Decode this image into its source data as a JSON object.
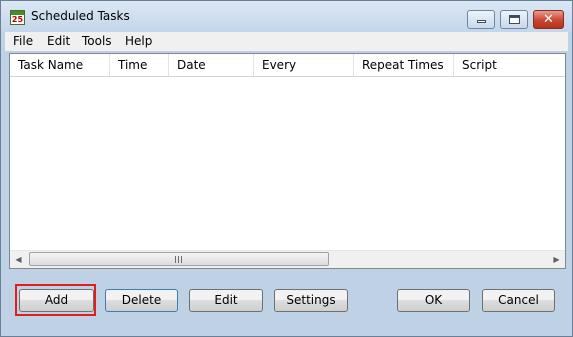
{
  "window": {
    "title": "Scheduled Tasks",
    "icon_name": "calendar-icon",
    "icon_day": "25",
    "controls": {
      "minimize": "minimize-icon",
      "maximize": "maximize-icon",
      "close_glyph": "✕"
    }
  },
  "menu": [
    "File",
    "Edit",
    "Tools",
    "Help"
  ],
  "table": {
    "columns": [
      "Task Name",
      "Time",
      "Date",
      "Every",
      "Repeat Times",
      "Script"
    ],
    "rows": []
  },
  "scrollbar": {
    "grip_icon": "grip-icon",
    "left_arrow": "◀",
    "right_arrow": "▶"
  },
  "buttons": {
    "add": "Add",
    "delete": "Delete",
    "edit": "Edit",
    "settings": "Settings",
    "ok": "OK",
    "cancel": "Cancel"
  },
  "colors": {
    "highlight": "#e01e1e",
    "window_bg": "#bfd1e5",
    "close_button": "#c8452f"
  }
}
